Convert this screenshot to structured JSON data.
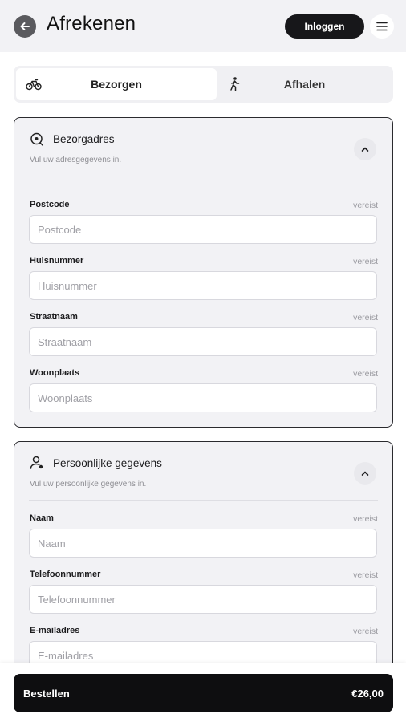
{
  "header": {
    "title": "Afrekenen",
    "login_label": "Inloggen"
  },
  "tabs": [
    {
      "label": "Bezorgen",
      "icon": "bicycle-icon",
      "active": true
    },
    {
      "label": "Afhalen",
      "icon": "walking-icon",
      "active": false
    }
  ],
  "delivery": {
    "title": "Bezorgadres",
    "subtitle": "Vul uw adresgegevens in.",
    "fields": [
      {
        "label": "Postcode",
        "required": "vereist",
        "placeholder": "Postcode"
      },
      {
        "label": "Huisnummer",
        "required": "vereist",
        "placeholder": "Huisnummer"
      },
      {
        "label": "Straatnaam",
        "required": "vereist",
        "placeholder": "Straatnaam"
      },
      {
        "label": "Woonplaats",
        "required": "vereist",
        "placeholder": "Woonplaats"
      }
    ]
  },
  "personal": {
    "title": "Persoonlijke gegevens",
    "subtitle": "Vul uw persoonlijke gegevens in.",
    "fields": [
      {
        "label": "Naam",
        "required": "vereist",
        "placeholder": "Naam"
      },
      {
        "label": "Telefoonnummer",
        "required": "vereist",
        "placeholder": "Telefoonnummer"
      },
      {
        "label": "E-mailadres",
        "required": "vereist",
        "placeholder": "E-mailadres"
      }
    ]
  },
  "footer": {
    "order_label": "Bestellen",
    "total": "€26,00"
  },
  "colors": {
    "accent": "#0e0e10",
    "background": "#f2f2f5"
  }
}
